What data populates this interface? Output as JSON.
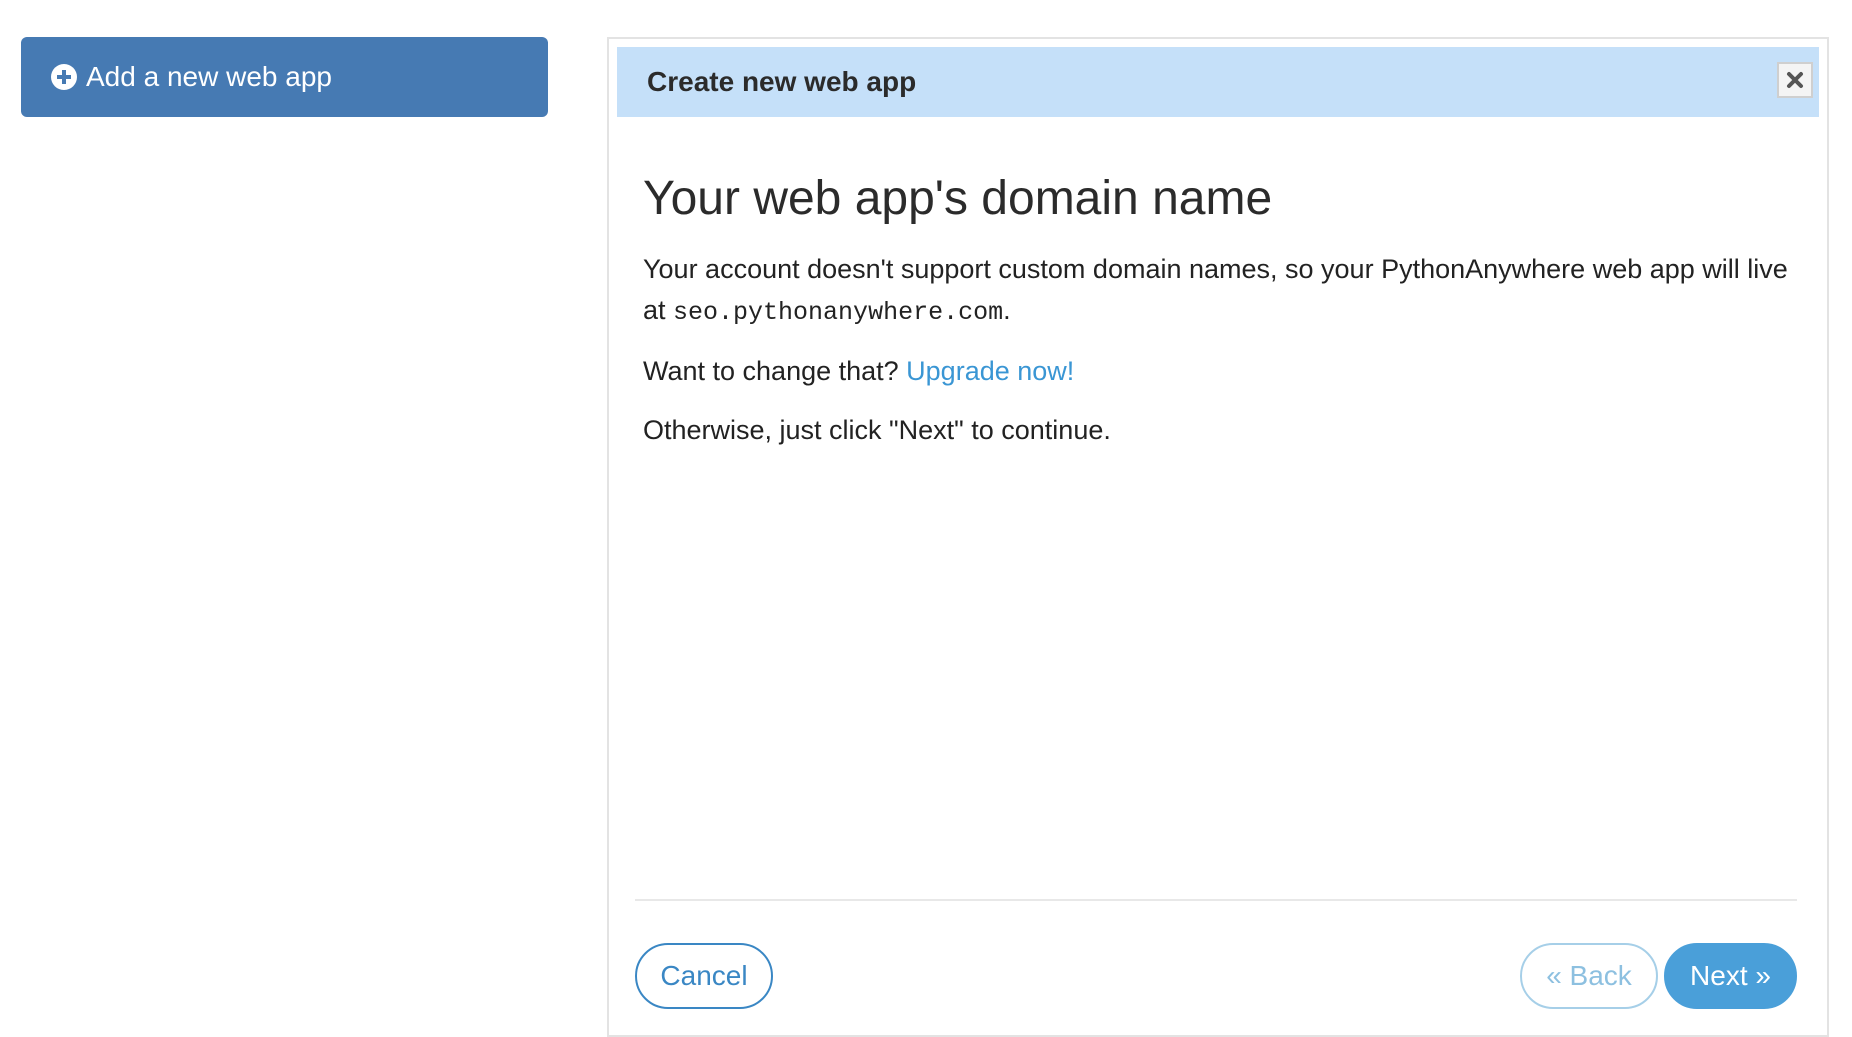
{
  "add_button": {
    "label": "Add a new web app",
    "icon": "plus-circle-icon"
  },
  "dialog": {
    "title": "Create new web app",
    "close_icon": "close-icon",
    "heading": "Your web app's domain name",
    "paragraph1_prefix": "Your account doesn't support custom domain names, so your PythonAnywhere web app will live at ",
    "domain": "seo.pythonanywhere.com",
    "paragraph1_suffix": ".",
    "paragraph2_prefix": "Want to change that? ",
    "upgrade_link": "Upgrade now!",
    "paragraph3": "Otherwise, just click \"Next\" to continue."
  },
  "footer": {
    "cancel_label": "Cancel",
    "back_label": "« Back",
    "next_label": "Next »"
  },
  "colors": {
    "primary_button": "#467ab3",
    "header_bg": "#c5e0f9",
    "link": "#3a96d4",
    "next_button": "#4a9fd9"
  }
}
